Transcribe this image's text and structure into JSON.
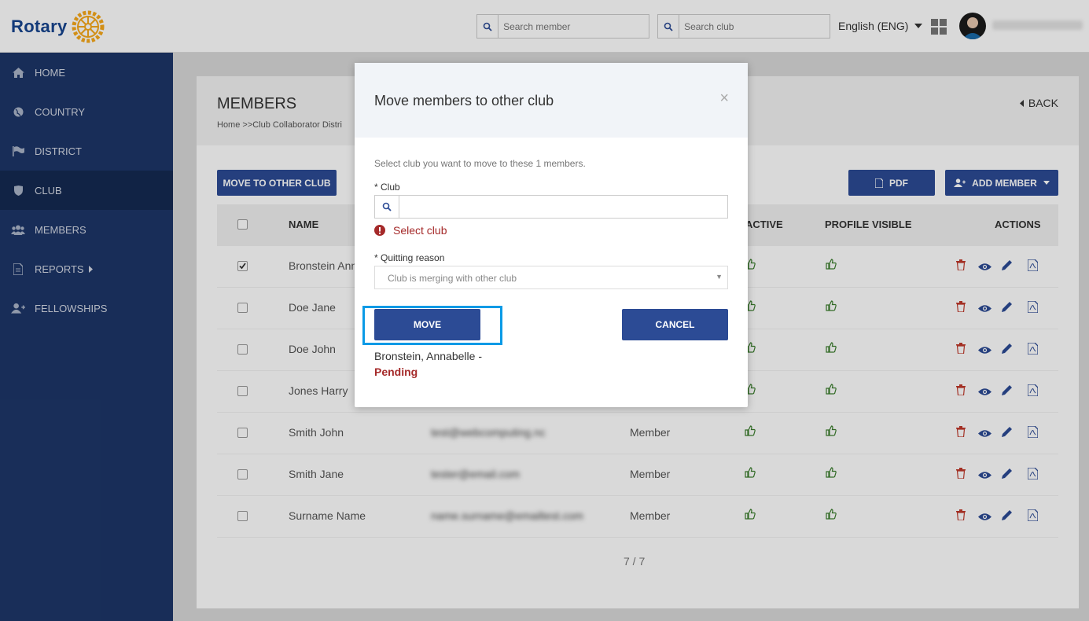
{
  "header": {
    "logo_text": "Rotary",
    "search_member_placeholder": "Search member",
    "search_club_placeholder": "Search club",
    "language": "English (ENG)"
  },
  "sidebar": {
    "items": [
      {
        "label": "HOME"
      },
      {
        "label": "COUNTRY"
      },
      {
        "label": "DISTRICT"
      },
      {
        "label": "CLUB"
      },
      {
        "label": "MEMBERS"
      },
      {
        "label": "REPORTS"
      },
      {
        "label": "FELLOWSHIPS"
      }
    ]
  },
  "page": {
    "title": "MEMBERS",
    "breadcrumb": "Home >>Club Collaborator Distri",
    "back_label": "BACK",
    "move_button": "MOVE TO OTHER CLUB",
    "pdf_button": "PDF",
    "add_member_button": "ADD MEMBER"
  },
  "table": {
    "columns": {
      "name": "NAME",
      "active": "ACTIVE",
      "profile_visible": "PROFILE VISIBLE",
      "actions": "ACTIONS"
    },
    "rows": [
      {
        "name": "Bronstein Ann",
        "email": "",
        "role": "",
        "checked": true
      },
      {
        "name": "Doe Jane",
        "email": "",
        "role": "",
        "checked": false
      },
      {
        "name": "Doe John",
        "email": "",
        "role": "",
        "checked": false
      },
      {
        "name": "Jones Harry",
        "email": "",
        "role": "",
        "checked": false
      },
      {
        "name": "Smith John",
        "email": "test@webcomputing.nc",
        "role": "Member",
        "checked": false
      },
      {
        "name": "Smith Jane",
        "email": "tester@email.com",
        "role": "Member",
        "checked": false
      },
      {
        "name": "Surname Name",
        "email": "name.surname@emailtest.com",
        "role": "Member",
        "checked": false
      }
    ],
    "pager": "7 / 7"
  },
  "modal": {
    "title": "Move members to other club",
    "close_symbol": "×",
    "intro": "Select club you want to move to these 1 members.",
    "club_label": "* Club",
    "club_value": "",
    "error_text": "Select club",
    "reason_label": "* Quitting reason",
    "reason_value": "Club is merging with other club",
    "move_label": "MOVE",
    "cancel_label": "CANCEL",
    "member_line": "Bronstein, Annabelle -",
    "member_status": "Pending"
  },
  "colors": {
    "primary": "#2c4b95",
    "sidebar": "#1d3668",
    "error": "#a52a2a",
    "thumb_green": "#3a7d2c",
    "highlight": "#0a9ae6"
  }
}
